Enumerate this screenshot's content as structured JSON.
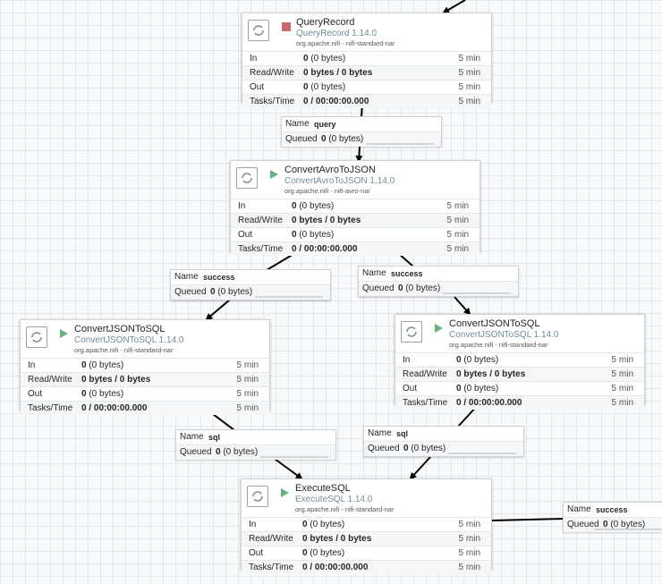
{
  "processors": [
    {
      "id": "p1",
      "name": "QueryRecord",
      "type": "QueryRecord 1.14.0",
      "bundle": "org.apache.nifi - nifi-standard-nar",
      "state": "stopped",
      "stats": [
        {
          "label": "In",
          "value": "0",
          "detail": "(0 bytes)",
          "time": "5 min"
        },
        {
          "label": "Read/Write",
          "value": "0 bytes / 0 bytes",
          "detail": "",
          "time": "5 min"
        },
        {
          "label": "Out",
          "value": "0",
          "detail": "(0 bytes)",
          "time": "5 min"
        },
        {
          "label": "Tasks/Time",
          "value": "0 / 00:00:00.000",
          "detail": "",
          "time": "5 min"
        }
      ]
    },
    {
      "id": "p2",
      "name": "ConvertAvroToJSON",
      "type": "ConvertAvroToJSON 1.14.0",
      "bundle": "org.apache.nifi - nifi-avro-nar",
      "state": "running",
      "stats": [
        {
          "label": "In",
          "value": "0",
          "detail": "(0 bytes)",
          "time": "5 min"
        },
        {
          "label": "Read/Write",
          "value": "0 bytes / 0 bytes",
          "detail": "",
          "time": "5 min"
        },
        {
          "label": "Out",
          "value": "0",
          "detail": "(0 bytes)",
          "time": "5 min"
        },
        {
          "label": "Tasks/Time",
          "value": "0 / 00:00:00.000",
          "detail": "",
          "time": "5 min"
        }
      ]
    },
    {
      "id": "p3",
      "name": "ConvertJSONToSQL",
      "type": "ConvertJSONToSQL 1.14.0",
      "bundle": "org.apache.nifi - nifi-standard-nar",
      "state": "running",
      "stats": [
        {
          "label": "In",
          "value": "0",
          "detail": "(0 bytes)",
          "time": "5 min"
        },
        {
          "label": "Read/Write",
          "value": "0 bytes / 0 bytes",
          "detail": "",
          "time": "5 min"
        },
        {
          "label": "Out",
          "value": "0",
          "detail": "(0 bytes)",
          "time": "5 min"
        },
        {
          "label": "Tasks/Time",
          "value": "0 / 00:00:00.000",
          "detail": "",
          "time": "5 min"
        }
      ]
    },
    {
      "id": "p4",
      "name": "ConvertJSONToSQL",
      "type": "ConvertJSONToSQL 1.14.0",
      "bundle": "org.apache.nifi - nifi-standard-nar",
      "state": "running",
      "stats": [
        {
          "label": "In",
          "value": "0",
          "detail": "(0 bytes)",
          "time": "5 min"
        },
        {
          "label": "Read/Write",
          "value": "0 bytes / 0 bytes",
          "detail": "",
          "time": "5 min"
        },
        {
          "label": "Out",
          "value": "0",
          "detail": "(0 bytes)",
          "time": "5 min"
        },
        {
          "label": "Tasks/Time",
          "value": "0 / 00:00:00.000",
          "detail": "",
          "time": "5 min"
        }
      ]
    },
    {
      "id": "p5",
      "name": "ExecuteSQL",
      "type": "ExecuteSQL 1.14.0",
      "bundle": "org.apache.nifi - nifi-standard-nar",
      "state": "running",
      "stats": [
        {
          "label": "In",
          "value": "0",
          "detail": "(0 bytes)",
          "time": "5 min"
        },
        {
          "label": "Read/Write",
          "value": "0 bytes / 0 bytes",
          "detail": "",
          "time": "5 min"
        },
        {
          "label": "Out",
          "value": "0",
          "detail": "(0 bytes)",
          "time": "5 min"
        },
        {
          "label": "Tasks/Time",
          "value": "0 / 00:00:00.000",
          "detail": "",
          "time": "5 min"
        }
      ]
    }
  ],
  "connections": [
    {
      "id": "c1",
      "name_label": "Name",
      "name": "query",
      "queued_label": "Queued",
      "queued": "0",
      "queued_detail": "(0 bytes)"
    },
    {
      "id": "c2",
      "name_label": "Name",
      "name": "success",
      "queued_label": "Queued",
      "queued": "0",
      "queued_detail": "(0 bytes)"
    },
    {
      "id": "c3",
      "name_label": "Name",
      "name": "success",
      "queued_label": "Queued",
      "queued": "0",
      "queued_detail": "(0 bytes)"
    },
    {
      "id": "c4",
      "name_label": "Name",
      "name": "sql",
      "queued_label": "Queued",
      "queued": "0",
      "queued_detail": "(0 bytes)"
    },
    {
      "id": "c5",
      "name_label": "Name",
      "name": "sql",
      "queued_label": "Queued",
      "queued": "0",
      "queued_detail": "(0 bytes)"
    },
    {
      "id": "c6",
      "name_label": "Name",
      "name": "success",
      "queued_label": "Queued",
      "queued": "0",
      "queued_detail": "(0 bytes)"
    }
  ],
  "colors": {
    "stopped": "#c96a6a",
    "running": "#6ab27f",
    "type_text": "#728e9b"
  }
}
